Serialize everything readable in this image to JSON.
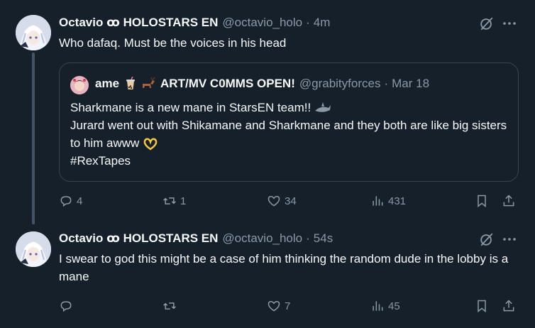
{
  "tweets": [
    {
      "author": {
        "name": "Octavio ꝏ HOLOSTARS EN",
        "handle": "@octavio_holo",
        "time": "4m"
      },
      "text": "Who dafaq. Must be the voices in his head",
      "quote": {
        "author": {
          "name": "ame",
          "name_suffix": "ART/MV C0MMS OPEN!",
          "handle": "@grabityforces",
          "time": "Mar 18"
        },
        "lines": [
          "Sharkmane is a new mane in StarsEN team!!",
          "Jurard went out with Shikamane and Sharkmane and they both are like big sisters to him awww",
          "#RexTapes"
        ]
      },
      "stats": {
        "replies": "4",
        "reposts": "1",
        "likes": "34",
        "views": "431"
      }
    },
    {
      "author": {
        "name": "Octavio ꝏ HOLOSTARS EN",
        "handle": "@octavio_holo",
        "time": "54s"
      },
      "text": "I swear to god this might be a case of him thinking the random dude in the lobby is a mane",
      "stats": {
        "replies": "",
        "reposts": "",
        "likes": "7",
        "views": "45"
      }
    }
  ],
  "colors": {
    "background": "#15202b",
    "text": "#f7f9f9",
    "muted": "#8b98a5",
    "border": "#38444d"
  }
}
